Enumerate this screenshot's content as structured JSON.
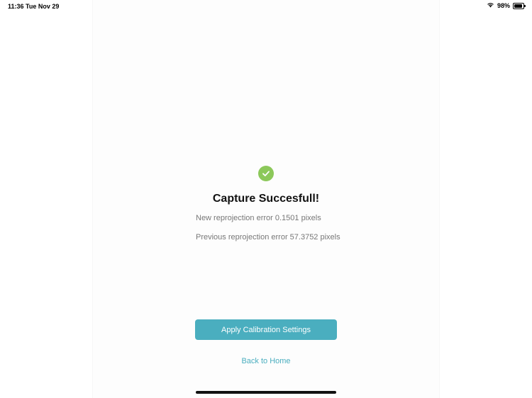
{
  "status_bar": {
    "time": "11:36",
    "date": "Tue Nov 29",
    "battery": "98%",
    "icons": [
      "wifi-icon",
      "battery-icon"
    ]
  },
  "result": {
    "icon": "check-circle-icon",
    "title": "Capture Succesfull!",
    "new_error": "New reprojection error 0.1501 pixels",
    "previous_error": "Previous reprojection error 57.3752 pixels"
  },
  "actions": {
    "apply_label": "Apply Calibration Settings",
    "back_label": "Back to Home"
  },
  "colors": {
    "accent": "#4aaebf",
    "success": "#8cc85a"
  }
}
